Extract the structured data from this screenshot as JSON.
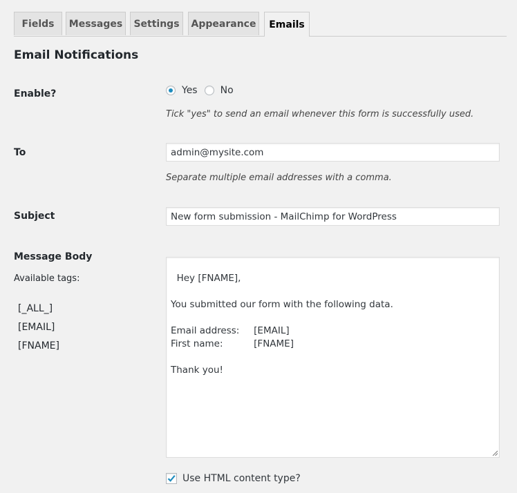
{
  "tabs": [
    {
      "label": "Fields",
      "active": false
    },
    {
      "label": "Messages",
      "active": false
    },
    {
      "label": "Settings",
      "active": false
    },
    {
      "label": "Appearance",
      "active": false
    },
    {
      "label": "Emails",
      "active": true
    }
  ],
  "section_title": "Email Notifications",
  "enable": {
    "label": "Enable?",
    "options": [
      {
        "label": "Yes",
        "checked": true
      },
      {
        "label": "No",
        "checked": false
      }
    ],
    "description": "Tick \"yes\" to send an email whenever this form is successfully used."
  },
  "to": {
    "label": "To",
    "value": "admin@mysite.com",
    "description": "Separate multiple email addresses with a comma."
  },
  "subject": {
    "label": "Subject",
    "value": "New form submission - MailChimp for WordPress"
  },
  "message_body": {
    "label": "Message Body",
    "tags_label": "Available tags:",
    "tags": [
      "[_ALL_]",
      "[EMAIL]",
      "[FNAME]"
    ],
    "value": "Hey [FNAME],\n\nYou submitted our form with the following data.\n\nEmail address:\t[EMAIL]\nFirst name:\t\t[FNAME]\n\nThank you!"
  },
  "html_content_type": {
    "label": "Use HTML content type?",
    "checked": true
  },
  "colors": {
    "accent": "#1e8cbe",
    "background": "#f1f1f1",
    "tab_inactive": "#e4e4e4",
    "border": "#cccccc"
  }
}
